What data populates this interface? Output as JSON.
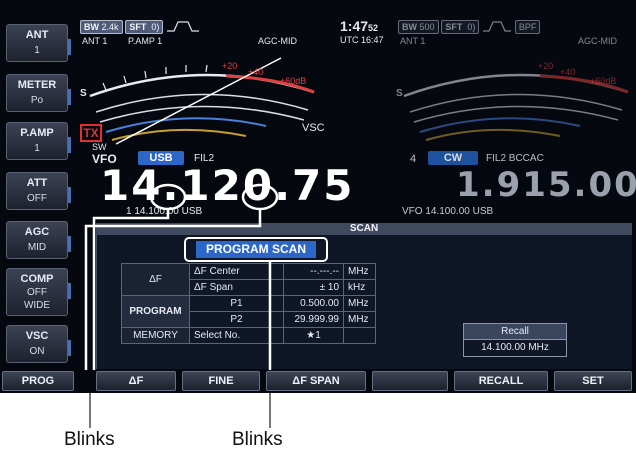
{
  "left_keys": [
    {
      "name": "ANT",
      "value": "1"
    },
    {
      "name": "METER",
      "value": "Po"
    },
    {
      "name": "P.AMP",
      "value": "1"
    },
    {
      "name": "ATT",
      "value": "OFF"
    },
    {
      "name": "AGC",
      "value": "MID"
    },
    {
      "name": "COMP",
      "value": "OFF",
      "value2": "WIDE"
    },
    {
      "name": "VSC",
      "value": "ON"
    }
  ],
  "main_status": {
    "bw_tag": "BW",
    "bw_value": "2.4k",
    "sft_tag": "SFT",
    "sft_value": "0",
    "ant": "ANT 1",
    "pamp": "P.AMP 1",
    "agc": "AGC-MID",
    "tx": "TX",
    "sw": "SW",
    "vsc": "VSC",
    "vfo": "VFO",
    "mode": "USB",
    "fil": "FIL2",
    "frequency": "14.120.75",
    "sub_info": "1  14.100.00  USB"
  },
  "clock": {
    "time": "1:47",
    "seconds": "52",
    "utc": "UTC 16:47"
  },
  "sub_status": {
    "bw_tag": "BW",
    "bw_value": "500",
    "sft_tag": "SFT",
    "sft_value": "0",
    "bpf": "BPF",
    "ant": "ANT 1",
    "agc": "AGC-MID",
    "channel": "4",
    "mode": "CW",
    "fil": "FIL2  BCCAC",
    "frequency": "1.915.00",
    "vfo_info": "VFO  14.100.00  USB"
  },
  "meter_scale": {
    "s": "S",
    "p20": "+20",
    "p40": "+40",
    "p60": "+60dB"
  },
  "scan": {
    "title": "SCAN",
    "header": "PROGRAM SCAN",
    "rows": [
      {
        "group": "ΔF",
        "label": "ΔF Center",
        "value": "--.---.--",
        "unit": "MHz"
      },
      {
        "group": "",
        "label": "ΔF Span",
        "value": "±  10",
        "unit": "kHz"
      },
      {
        "group": "PROGRAM",
        "label": "P1",
        "value": "0.500.00",
        "unit": "MHz"
      },
      {
        "group": "",
        "label": "P2",
        "value": "29.999.99",
        "unit": "MHz"
      },
      {
        "group": "MEMORY",
        "label": "Select No.",
        "value": "★1",
        "unit": ""
      }
    ],
    "recall_title": "Recall",
    "recall_value": "14.100.00  MHz"
  },
  "function_keys": [
    "PROG",
    "ΔF",
    "FINE",
    "ΔF SPAN",
    "",
    "RECALL",
    "SET"
  ],
  "callouts": [
    "Blinks",
    "Blinks"
  ]
}
